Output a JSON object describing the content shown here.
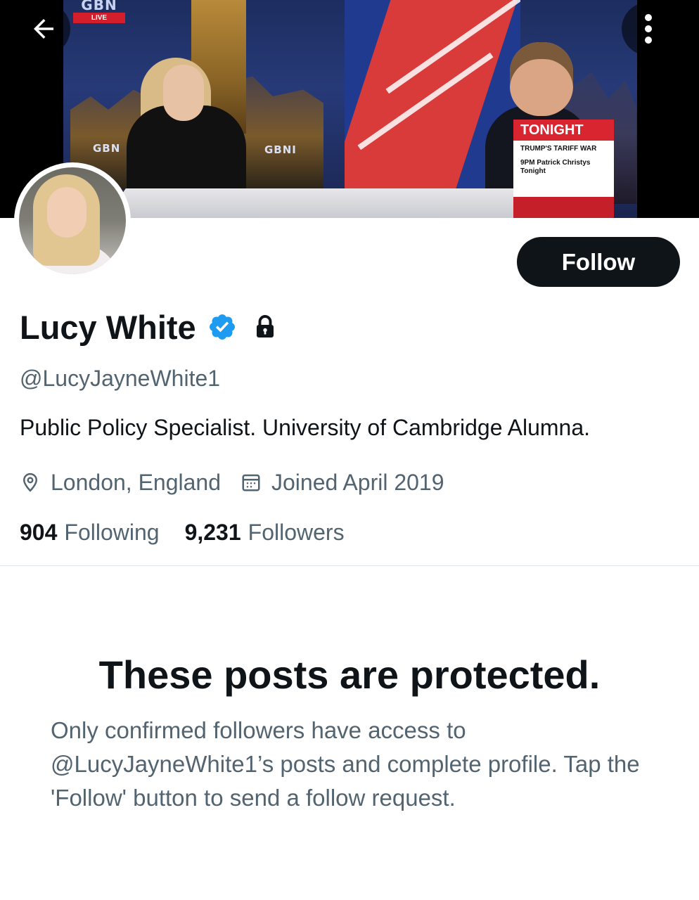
{
  "banner": {
    "channel_logo": "GBN",
    "live_label": "LIVE",
    "desk_logo_left": "GBN",
    "desk_logo_right": "GBNI",
    "tonight_card": {
      "heading": "TONIGHT",
      "line1": "TRUMP'S TARIFF WAR",
      "line2": "9PM Patrick Christys Tonight"
    }
  },
  "header": {
    "back_icon": "arrow-left-icon",
    "more_icon": "more-vertical-icon"
  },
  "profile": {
    "display_name": "Lucy White",
    "verified_icon": "verified-badge-icon",
    "protected_icon": "lock-icon",
    "handle": "@LucyJayneWhite1",
    "bio": "Public Policy Specialist. University of Cambridge Alumna.",
    "location": "London, England",
    "location_icon": "location-pin-icon",
    "joined": "Joined April 2019",
    "joined_icon": "calendar-icon",
    "following_count": "904",
    "following_label": "Following",
    "followers_count": "9,231",
    "followers_label": "Followers"
  },
  "actions": {
    "follow_label": "Follow"
  },
  "protected_notice": {
    "title": "These posts are protected.",
    "description": "Only confirmed followers have access to @LucyJayneWhite1’s posts and complete profile. Tap the 'Follow' button to send a follow request."
  },
  "colors": {
    "text_primary": "#0f1419",
    "text_secondary": "#536471",
    "verified_blue": "#1d9bf0",
    "follow_button_bg": "#0f1419",
    "divider": "#e1e8ed"
  }
}
